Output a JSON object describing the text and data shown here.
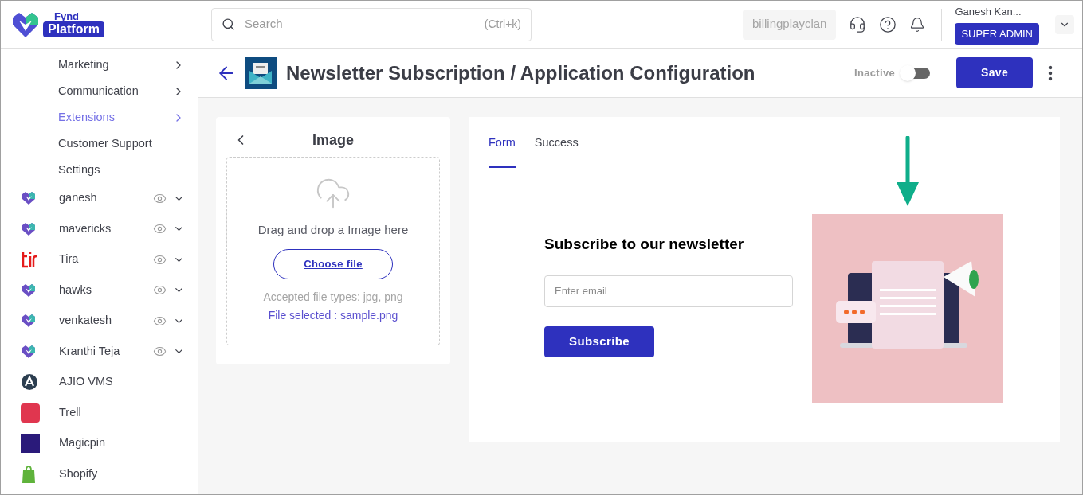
{
  "logo": {
    "line_1": "Fynd",
    "line_2": "Platform"
  },
  "search": {
    "placeholder": "Search",
    "shortcut": "(Ctrl+k)"
  },
  "topbar": {
    "company": "billingplayclan",
    "user_name": "Ganesh Kan...",
    "role": "SUPER ADMIN"
  },
  "sidebar": {
    "items": [
      {
        "kind": "menu",
        "label": "Marketing",
        "selected": false,
        "has_arrow": true
      },
      {
        "kind": "menu",
        "label": "Communication",
        "selected": false,
        "has_arrow": true
      },
      {
        "kind": "menu",
        "label": "Extensions",
        "selected": true,
        "has_arrow": true
      },
      {
        "kind": "menu",
        "label": "Customer Support",
        "selected": false,
        "has_arrow": false
      },
      {
        "kind": "menu",
        "label": "Settings",
        "selected": false,
        "has_arrow": false
      },
      {
        "kind": "fynd_store",
        "label": "ganesh",
        "has_actions": true
      },
      {
        "kind": "fynd_store",
        "label": "mavericks",
        "has_actions": true
      },
      {
        "kind": "tira_store",
        "label": "Tira",
        "has_actions": true
      },
      {
        "kind": "fynd_store",
        "label": "hawks",
        "has_actions": true
      },
      {
        "kind": "fynd_store",
        "label": "venkatesh",
        "has_actions": true
      },
      {
        "kind": "fynd_store",
        "label": "Kranthi Teja",
        "has_actions": true
      },
      {
        "kind": "ajio_store",
        "label": "AJIO VMS",
        "has_actions": false
      },
      {
        "kind": "trell_store",
        "label": "Trell",
        "has_actions": false
      },
      {
        "kind": "magicpin_store",
        "label": "Magicpin",
        "has_actions": false
      },
      {
        "kind": "shopify_store",
        "label": "Shopify",
        "has_actions": false
      }
    ]
  },
  "page": {
    "title": "Newsletter Subscription / Application Configuration",
    "status_label": "Inactive",
    "active": false,
    "save": "Save"
  },
  "image_panel": {
    "title": "Image",
    "drop_text": "Drag and drop a Image here",
    "choose": "Choose file",
    "accepted": "Accepted file types: jpg, png",
    "selected_file": "File selected : sample.png"
  },
  "preview": {
    "tabs": [
      {
        "label": "Form",
        "selected": true
      },
      {
        "label": "Success",
        "selected": false
      }
    ],
    "heading": "Subscribe to our newsletter",
    "email_placeholder": "Enter email",
    "button": "Subscribe"
  }
}
